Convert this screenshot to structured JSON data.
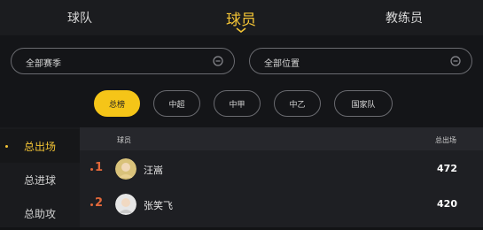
{
  "top_tabs": [
    {
      "label": "球队",
      "active": false
    },
    {
      "label": "球员",
      "active": true
    },
    {
      "label": "教练员",
      "active": false
    }
  ],
  "filters": {
    "season": "全部赛季",
    "position": "全部位置",
    "chips": [
      {
        "label": "总榜",
        "active": true
      },
      {
        "label": "中超",
        "active": false
      },
      {
        "label": "中甲",
        "active": false
      },
      {
        "label": "中乙",
        "active": false
      },
      {
        "label": "国家队",
        "active": false
      }
    ]
  },
  "sidebar": {
    "items": [
      {
        "label": "总出场",
        "active": true
      },
      {
        "label": "总进球",
        "active": false
      },
      {
        "label": "总助攻",
        "active": false
      }
    ]
  },
  "table": {
    "header_player": "球员",
    "header_stat": "总出场",
    "rows": [
      {
        "rank": "1",
        "name": "汪嵩",
        "value": "472"
      },
      {
        "rank": "2",
        "name": "张笑飞",
        "value": "420"
      }
    ]
  },
  "colors": {
    "accent": "#f5c518",
    "rank": "#e2683a",
    "background": "#121315"
  }
}
